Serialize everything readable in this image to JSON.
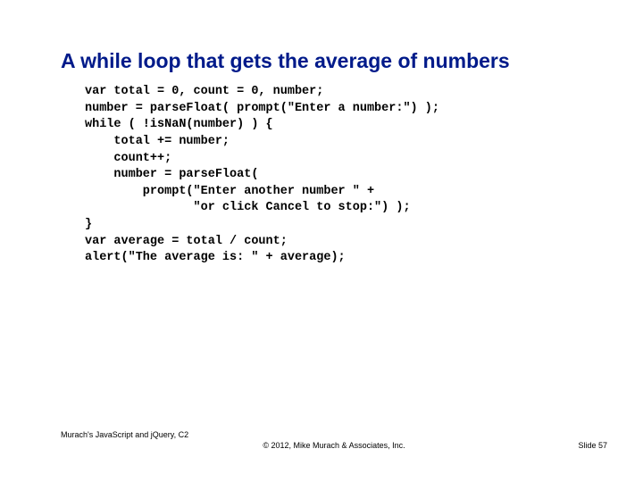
{
  "title": "A while loop that gets the average of numbers",
  "code_lines": [
    "var total = 0, count = 0, number;",
    "number = parseFloat( prompt(\"Enter a number:\") );",
    "while ( !isNaN(number) ) {",
    "    total += number;",
    "    count++;",
    "    number = parseFloat(",
    "        prompt(\"Enter another number \" +",
    "               \"or click Cancel to stop:\") );",
    "}",
    "var average = total / count;",
    "alert(\"The average is: \" + average);"
  ],
  "footer": {
    "left": "Murach's JavaScript and jQuery, C2",
    "center": "© 2012, Mike Murach & Associates, Inc.",
    "right": "Slide 57"
  }
}
